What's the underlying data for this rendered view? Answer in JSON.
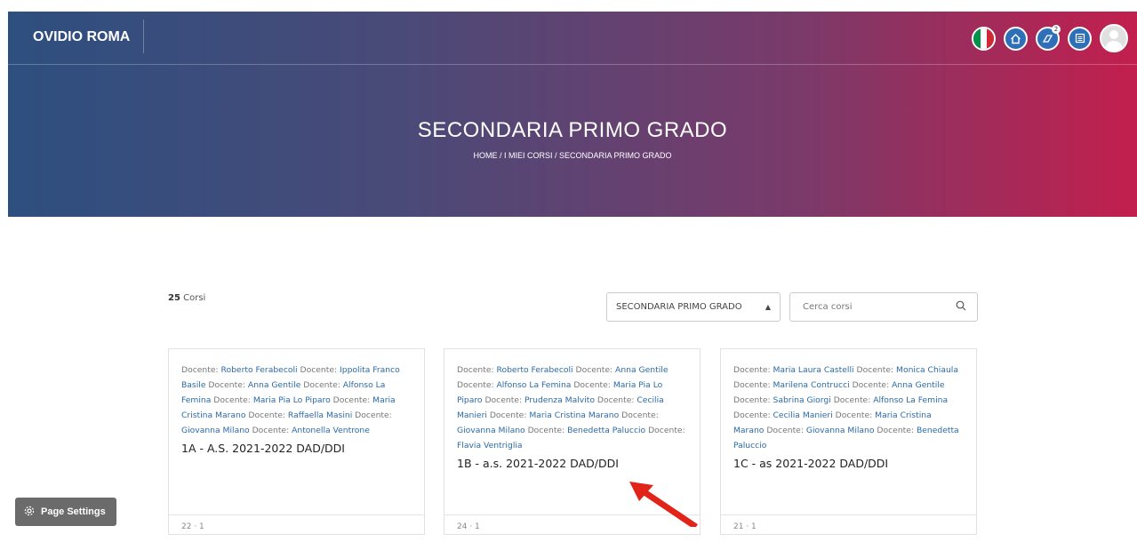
{
  "header": {
    "brand": "OVIDIO ROMA",
    "badge_count": "2",
    "flag_colors": [
      "#009246",
      "#ffffff",
      "#ce2b37"
    ]
  },
  "hero": {
    "title": "SECONDARIA PRIMO GRADO",
    "breadcrumb": "HOME / I MIEI CORSI / SECONDARIA PRIMO GRADO"
  },
  "toolbar": {
    "count_number": "25",
    "count_label": "Corsi",
    "category_selected": "SECONDARIA PRIMO GRADO",
    "search_placeholder": "Cerca corsi"
  },
  "courses": [
    {
      "title": "1A - A.S. 2021-2022 DAD/DDI",
      "teachers": [
        "Roberto Ferabecoli",
        "Ippolita Franco Basile",
        "Anna Gentile",
        "Alfonso La Femina",
        "Maria Pia Lo Piparo",
        "Maria Cristina Marano",
        "Raffaella Masini",
        "Giovanna Milano",
        "Antonella Ventrone"
      ],
      "meta": "22 · 1"
    },
    {
      "title": "1B - a.s. 2021-2022 DAD/DDI",
      "teachers": [
        "Roberto Ferabecoli",
        "Anna Gentile",
        "Alfonso La Femina",
        "Maria Pia Lo Piparo",
        "Prudenza Malvito",
        "Cecilia Manieri",
        "Maria Cristina Marano",
        "Giovanna Milano",
        "Benedetta Paluccio",
        "Flavia Ventriglia"
      ],
      "meta": "24 · 1"
    },
    {
      "title": "1C - as 2021-2022 DAD/DDI",
      "teachers": [
        "Maria Laura Castelli",
        "Monica Chiaula",
        "Marilena Contrucci",
        "Anna Gentile",
        "Sabrina Giorgi",
        "Alfonso La Femina",
        "Cecilia Manieri",
        "Maria Cristina Marano",
        "Giovanna Milano",
        "Benedetta Paluccio"
      ],
      "meta": "21 · 1"
    }
  ],
  "teacher_label": "Docente:",
  "page_settings_label": "Page Settings",
  "colors": {
    "accent_blue": "#2f6fb8",
    "link": "#2b6aa8",
    "arrow": "#e2231a"
  }
}
